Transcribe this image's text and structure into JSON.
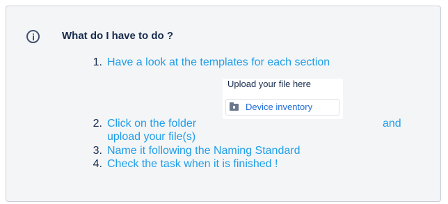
{
  "panel": {
    "icon": "info-icon",
    "heading": "What do I have to do ?"
  },
  "steps": [
    {
      "number": "1.",
      "text": "Have a look at the templates for each section"
    },
    {
      "number": "2.",
      "text_a": "Click on the folder",
      "text_b": "and",
      "text_c": "upload your  file(s)"
    },
    {
      "number": "3.",
      "text": "Name it following the Naming Standard"
    },
    {
      "number": "4.",
      "text": "Check the task when it is finished !"
    }
  ],
  "upload_widget": {
    "label": "Upload your file here",
    "button_icon": "folder-icon",
    "button_label": "Device inventory"
  },
  "colors": {
    "link": "#1e9ee8",
    "text": "#172b4d",
    "panel_bg": "#f4f5f7",
    "panel_border": "#c9ced6"
  }
}
